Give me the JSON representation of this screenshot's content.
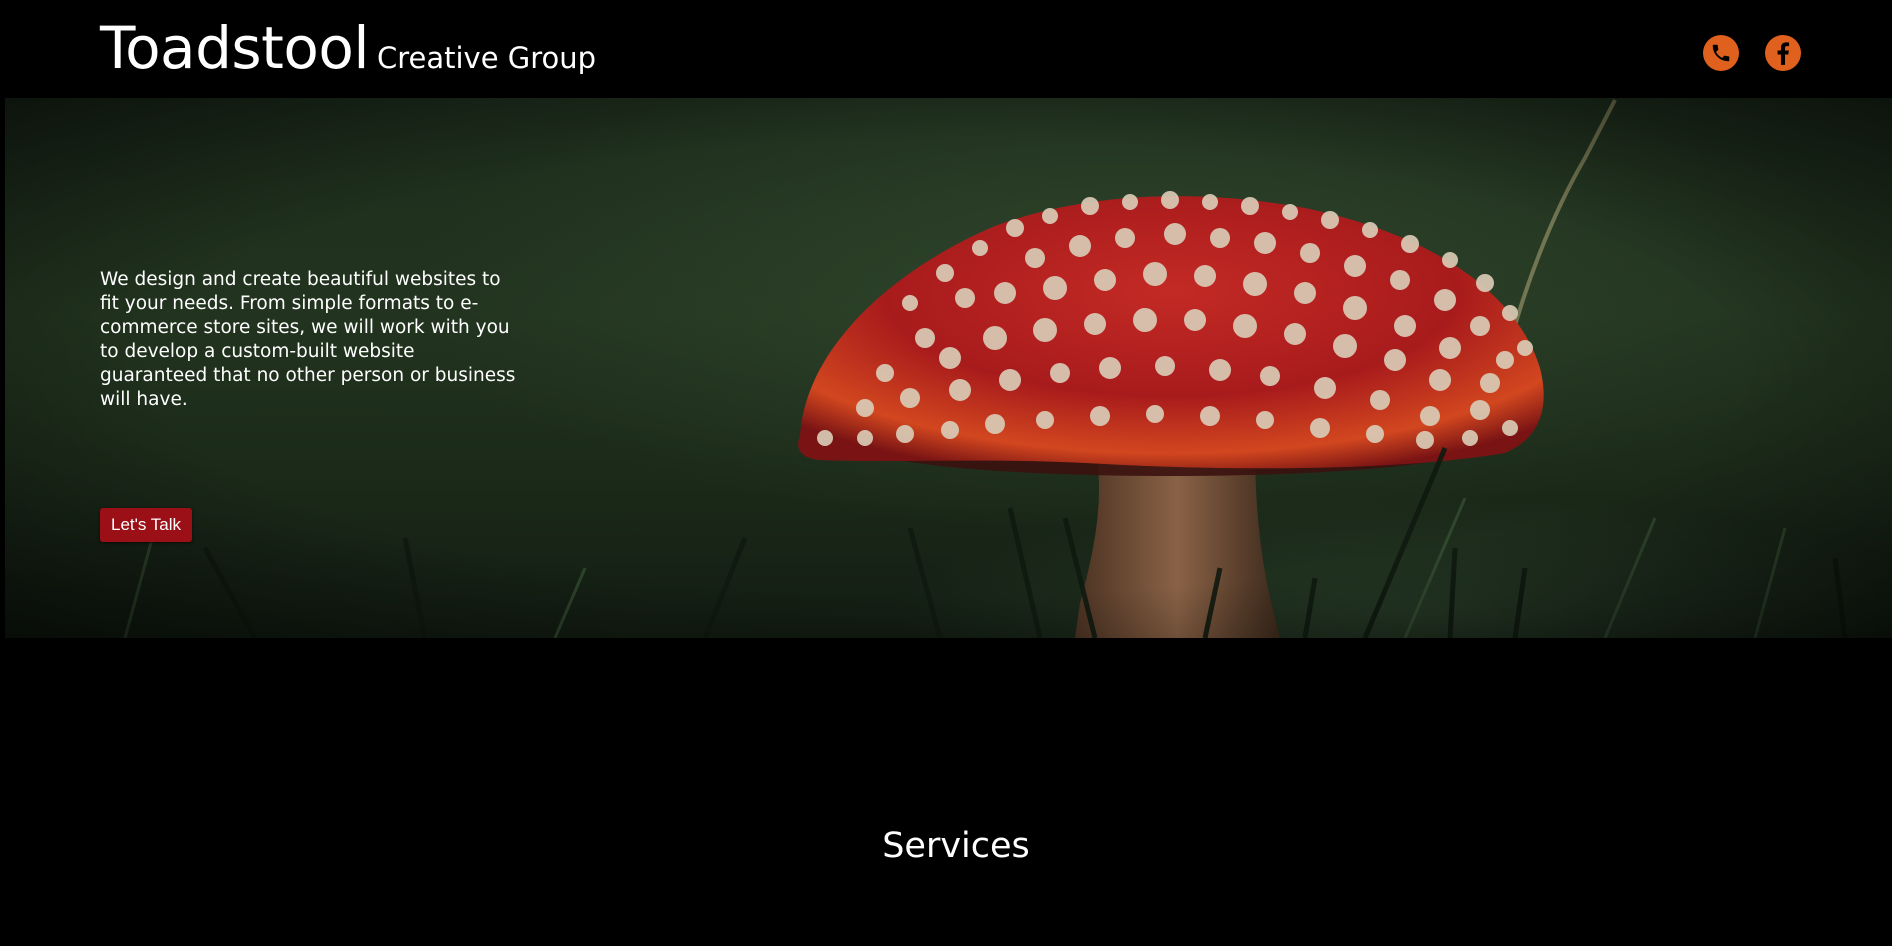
{
  "header": {
    "brand_name": "Toadstool",
    "brand_tagline": "Creative Group",
    "icons": [
      "phone-icon",
      "facebook-icon"
    ],
    "accent_color": "#e0601d"
  },
  "hero": {
    "description": "We design and create beautiful websites to fit your needs. From simple formats to e-commerce store sites, we will work with you to develop a custom-built website guaranteed that no other person or business will have.",
    "cta_label": "Let's Talk",
    "cta_color": "#9b0f17"
  },
  "services": {
    "heading": "Services"
  }
}
